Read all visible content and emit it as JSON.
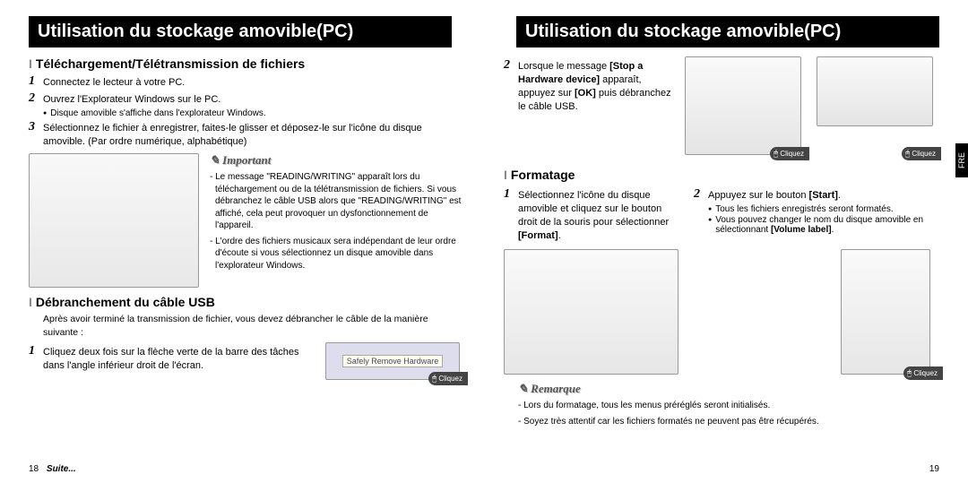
{
  "title_left": "Utilisation du stockage amovible(PC)",
  "title_right": "Utilisation du stockage amovible(PC)",
  "side_tab": "FRE",
  "page_left_num": "18",
  "page_right_num": "19",
  "suite": "Suite...",
  "click_label": "Cliquez",
  "sec1": {
    "title": "Téléchargement/Télétransmission de fichiers",
    "step1": "Connectez le lecteur à votre PC.",
    "step2": "Ouvrez l'Explorateur Windows sur le PC.",
    "step2_b": "Disque amovible s'affiche dans l'explorateur Windows.",
    "step3": "Sélectionnez le fichier à enregistrer, faites-le glisser et déposez-le sur l'icône du disque amovible. (Par ordre numérique, alphabétique)"
  },
  "important": {
    "title": "Important",
    "p1": "- Le message \"READING/WRITING\" apparaît lors du téléchargement ou de la télétransmission de fichiers. Si vous débranchez le câble USB alors que \"READING/WRITING\" est affiché, cela peut provoquer un dysfonctionnement de l'appareil.",
    "p2": "- L'ordre des fichiers musicaux sera indépendant de leur ordre d'écoute si vous sélectionnez un disque amovible dans l'explorateur Windows."
  },
  "sec2": {
    "title": "Débranchement du câble USB",
    "intro": "Après avoir terminé la transmission de fichier, vous devez débrancher le câble de la manière suivante :",
    "step1": "Cliquez deux fois sur la flèche verte de la barre des tâches dans l'angle inférieur droit de l'écran.",
    "tray_tip": "Safely Remove Hardware"
  },
  "sec3": {
    "step2_a": "Lorsque le message",
    "step2_b": "[Stop a Hardware device]",
    "step2_c": "apparaît, appuyez sur",
    "step2_ok": "[OK]",
    "step2_d": "puis débranchez le câble USB."
  },
  "sec4": {
    "title": "Formatage",
    "step1": "Sélectionnez l'icône du disque amovible et cliquez sur le bouton droit de la souris pour sélectionner",
    "step1_b": "[Format]",
    "step1_end": ".",
    "step2_a": "Appuyez sur le bouton",
    "step2_b": "[Start]",
    "step2_end": ".",
    "bul1": "Tous les fichiers enregistrés seront formatés.",
    "bul2a": "Vous pouvez changer le nom du disque amovible en sélectionnant",
    "bul2b": "[Volume label]",
    "bul2end": "."
  },
  "remarque": {
    "title": "Remarque",
    "p1": "- Lors du formatage, tous les menus préréglés seront initialisés.",
    "p2": "- Soyez très attentif car les fichiers formatés ne peuvent pas être récupérés."
  }
}
